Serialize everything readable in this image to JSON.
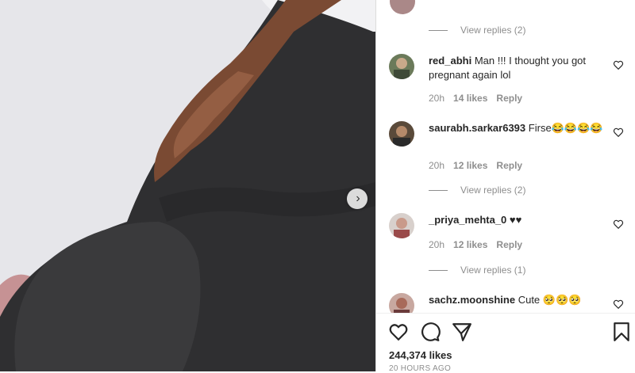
{
  "post": {
    "author": "",
    "likes": "244,374 likes",
    "time_ago": "20 HOURS AGO"
  },
  "comments_top": {
    "view_replies": "View replies (2)"
  },
  "comments": [
    {
      "user": "red_abhi",
      "text": "Man !!! I thought you got pregnant again lol",
      "time": "20h",
      "likes": "14 likes",
      "reply": "Reply"
    },
    {
      "user": "saurabh.sarkar6393",
      "text": "Firse😂😂😂😂",
      "time": "20h",
      "likes": "12 likes",
      "reply": "Reply",
      "view_replies": "View replies (2)"
    },
    {
      "user": "_priya_mehta_0",
      "text": "♥♥",
      "time": "20h",
      "likes": "12 likes",
      "reply": "Reply",
      "view_replies": "View replies (1)"
    },
    {
      "user": "sachz.moonshine",
      "text": "Cute 🥺🥺🥺",
      "time": "",
      "likes": "",
      "reply": ""
    }
  ],
  "icons": {
    "like": "heart-icon",
    "comment": "comment-bubble-icon",
    "share": "paper-plane-icon",
    "save": "bookmark-icon",
    "next": "chevron-right-icon"
  },
  "media": {
    "next_glyph": "›"
  }
}
